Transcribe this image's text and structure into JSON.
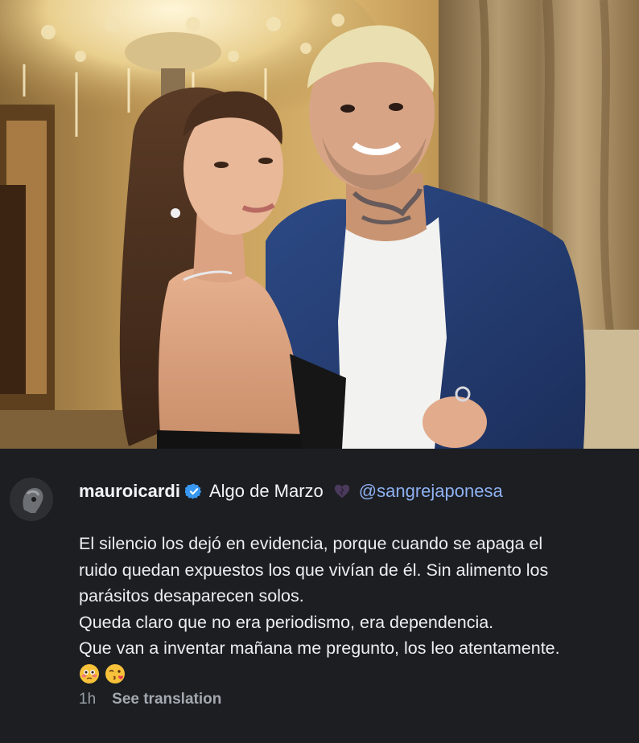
{
  "post": {
    "username": "mauroicardi",
    "song": "Algo de Marzo",
    "mention": "@sangrejaponesa",
    "caption_lines": [
      "El silencio los dejó en evidencia, porque cuando se apaga el",
      "ruido quedan expuestos los que vivían de él. Sin alimento los",
      "parásitos desaparecen solos.",
      "Queda claro que no era periodismo, era dependencia.",
      "Que van a inventar mañana me pregunto, los leo atentamente."
    ],
    "emojis": [
      "flushed-face-emoji",
      "kissing-heart-emoji"
    ],
    "timestamp": "1h",
    "see_translation": "See translation"
  },
  "icons": {
    "verified": "verified-badge-icon",
    "heart": "purple-heart-icon"
  },
  "colors": {
    "background": "#1c1e22",
    "text": "#eceef1",
    "mention": "#8fb1f2",
    "verified": "#3897f0",
    "meta": "#9aa0a8"
  }
}
